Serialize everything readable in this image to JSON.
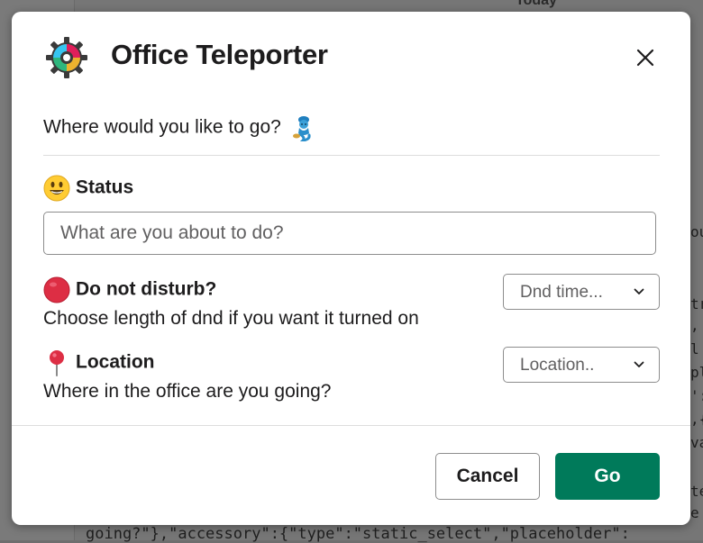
{
  "background": {
    "today_label": "Today",
    "right_fragments": [
      "ou",
      "tr",
      ",",
      "l",
      "pl",
      "':",
      ",{",
      "va",
      "te",
      "e"
    ],
    "bottom_code": "going?\"},\"accessory\":{\"type\":\"static_select\",\"placeholder\":"
  },
  "modal": {
    "app_icon": "gear-wheel-icon",
    "title": "Office Teleporter",
    "close_icon": "close-icon",
    "prompt": "Where would you like to go?",
    "prompt_emoji": "genie-emoji",
    "status": {
      "emoji": "smiley-emoji",
      "label": "Status",
      "placeholder": "What are you about to do?",
      "value": ""
    },
    "dnd": {
      "emoji": "red-circle-emoji",
      "label": "Do not disturb?",
      "description": "Choose length of dnd if you want it turned on",
      "select_placeholder": "Dnd time..."
    },
    "location": {
      "emoji": "round-pushpin-emoji",
      "label": "Location",
      "description": "Where in the office are you going?",
      "select_placeholder": "Location.."
    },
    "buttons": {
      "cancel": "Cancel",
      "go": "Go"
    }
  },
  "colors": {
    "primary": "#007a5a",
    "text": "#1d1c1d",
    "placeholder": "#616061",
    "border": "#8d8d8d"
  }
}
